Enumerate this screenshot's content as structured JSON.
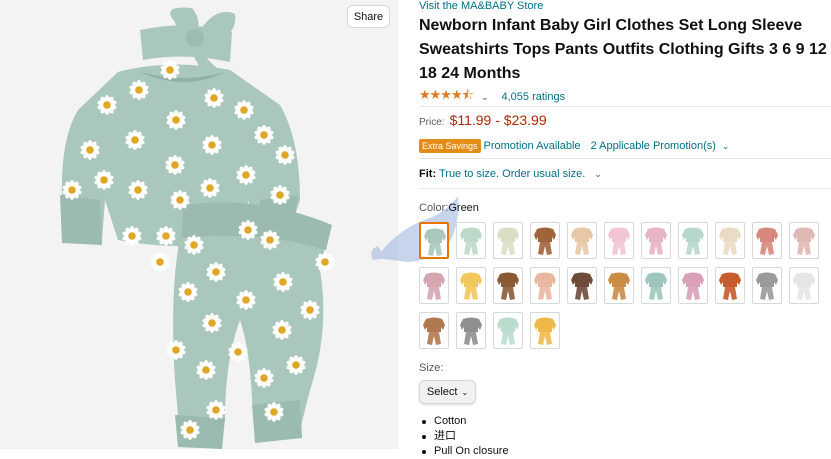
{
  "share": {
    "label": "Share"
  },
  "product": {
    "store_link": "Visit the MA&BABY Store",
    "title": "Newborn Infant Baby Girl Clothes Set Long Sleeve Sweatshirts Tops Pants Outfits Clothing Gifts 3 6 9 12 18 24 Months",
    "rating": {
      "stars": 4.5,
      "star_glyphs": "★★★★⯪",
      "chevron": "⌄",
      "count_text": "4,055 ratings"
    },
    "price": {
      "label": "Price:",
      "value": "$11.99 - $23.99"
    },
    "promotion": {
      "badge": "Extra Savings",
      "available": "Promotion Available",
      "applicable": "2 Applicable Promotion(s)",
      "chevron": "⌄"
    },
    "fit": {
      "label": "Fit:",
      "value": "True to size. Order usual size.",
      "chevron": "⌄"
    },
    "color": {
      "label": "Color:",
      "value": "Green"
    },
    "size": {
      "label": "Size:",
      "select_label": "Select",
      "chevron": "⌄"
    },
    "bullets": [
      "Cotton",
      "进口",
      "Pull On closure"
    ]
  },
  "swatches": [
    {
      "color": "#a9c7bd",
      "selected": true
    },
    {
      "color": "#bcd9c9"
    },
    {
      "color": "#d9dfc4"
    },
    {
      "color": "#a0633a"
    },
    {
      "color": "#e8c7a8"
    },
    {
      "color": "#f2c4d6"
    },
    {
      "color": "#e7b3c7"
    },
    {
      "color": "#b8d7cc"
    },
    {
      "color": "#e9dcc4"
    },
    {
      "color": "#d6887a"
    },
    {
      "color": "#e0b9b5"
    },
    {
      "color": "#d4a6b0"
    },
    {
      "color": "#f2c85a"
    },
    {
      "color": "#8a5a34"
    },
    {
      "color": "#e9b7a0"
    },
    {
      "color": "#6d4a3a"
    },
    {
      "color": "#c98c45"
    },
    {
      "color": "#9dc6bc"
    },
    {
      "color": "#d9a0b8"
    },
    {
      "color": "#c65b2c"
    },
    {
      "color": "#9a9a9a"
    },
    {
      "color": "#e5e5e5"
    },
    {
      "color": "#b07850"
    },
    {
      "color": "#8d8f90"
    },
    {
      "color": "#b9dccd"
    },
    {
      "color": "#efb94a"
    }
  ]
}
